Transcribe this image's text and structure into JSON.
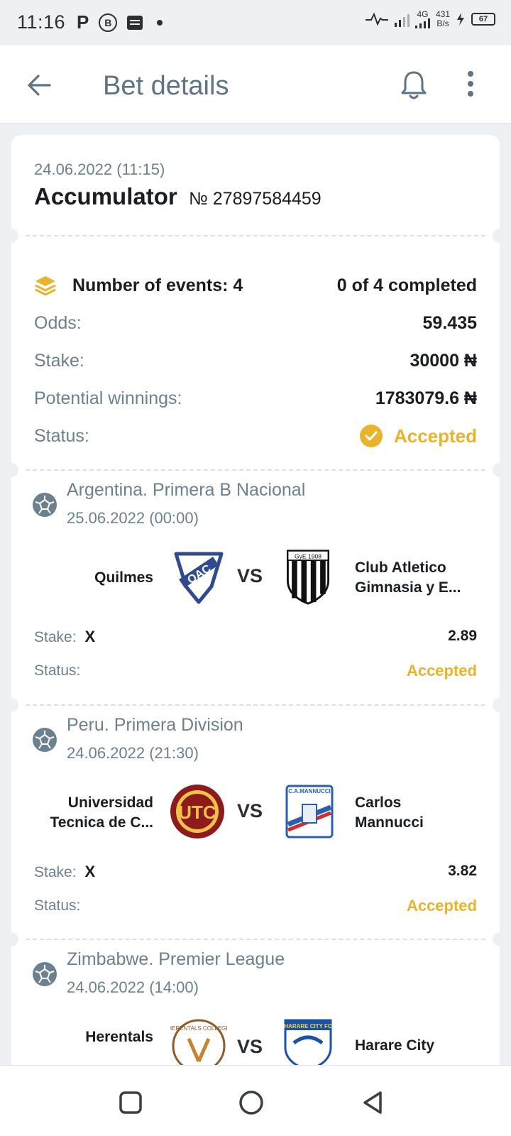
{
  "status_bar": {
    "time": "11:16",
    "notif_p": "P",
    "notif_b": "B",
    "network_type": "4G",
    "speed_value": "431",
    "speed_unit": "B/s",
    "battery": "67"
  },
  "header": {
    "title": "Bet details"
  },
  "bet": {
    "datetime": "24.06.2022 (11:15)",
    "type": "Accumulator",
    "number": "№ 27897584459",
    "events_label": "Number of events: 4",
    "completed": "0 of 4 completed",
    "odds_label": "Odds:",
    "odds_value": "59.435",
    "stake_label": "Stake:",
    "stake_value": "30000 ₦",
    "winnings_label": "Potential winnings:",
    "winnings_value": "1783079.6 ₦",
    "status_label": "Status:",
    "status_value": "Accepted"
  },
  "events": [
    {
      "league": "Argentina. Primera B Nacional",
      "date": "25.06.2022 (00:00)",
      "home_line1": "Quilmes",
      "home_line2": "",
      "away_line1": "Club Atletico",
      "away_line2": "Gimnasia y E...",
      "home_logo_text": "QAC",
      "away_logo_text": "GyE 1908",
      "vs": "VS",
      "stake_label": "Stake:",
      "pick": "X",
      "odds": "2.89",
      "status_label": "Status:",
      "status": "Accepted"
    },
    {
      "league": "Peru. Primera Division",
      "date": "24.06.2022 (21:30)",
      "home_line1": "Universidad",
      "home_line2": "Tecnica de C...",
      "away_line1": "Carlos",
      "away_line2": "Mannucci",
      "home_logo_text": "UTC",
      "away_logo_text": "C.A.MANNUCCI",
      "vs": "VS",
      "stake_label": "Stake:",
      "pick": "X",
      "odds": "3.82",
      "status_label": "Status:",
      "status": "Accepted"
    },
    {
      "league": "Zimbabwe. Premier League",
      "date": "24.06.2022 (14:00)",
      "home_line1": "Herentals",
      "home_line2": "",
      "away_line1": "Harare City",
      "away_line2": "",
      "home_logo_text": "HERENTALS COLLEGE",
      "away_logo_text": "HARARE CITY FC",
      "vs": "VS"
    }
  ],
  "colors": {
    "accent": "#e9b42b",
    "muted_text": "#6c8190",
    "background": "#eef1f4"
  },
  "icons": {
    "back": "arrow-left-icon",
    "bell": "bell-icon",
    "more": "more-vertical-icon",
    "events": "layers-icon",
    "status": "check-circle-icon",
    "sport": "soccer-ball-icon",
    "nav_recent": "square-icon",
    "nav_home": "circle-icon",
    "nav_back": "triangle-back-icon"
  }
}
